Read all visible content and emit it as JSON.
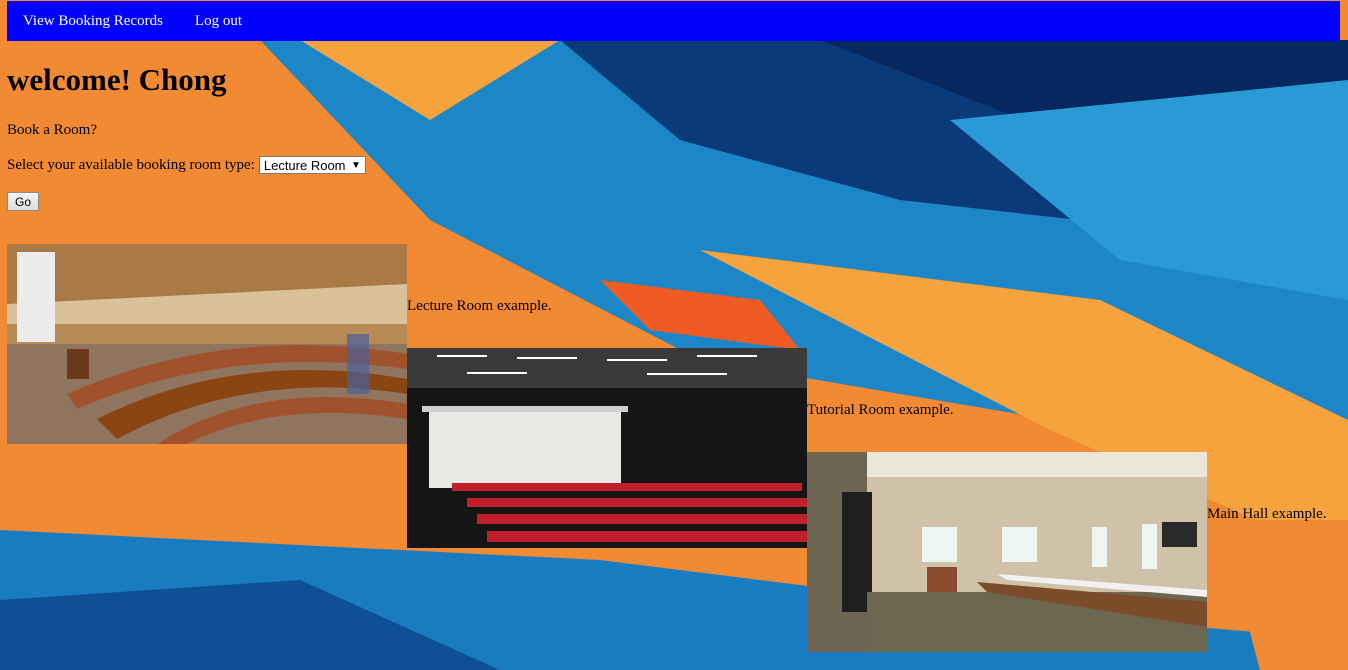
{
  "nav": {
    "links": [
      "View Booking Records",
      "Log out"
    ]
  },
  "welcome": "welcome! Chong",
  "book_prompt": "Book a Room?",
  "select_label": "Select your available booking room type:",
  "select_value": "Lecture Room",
  "go_label": "Go",
  "rooms": [
    {
      "caption": "Lecture Room example."
    },
    {
      "caption": "Tutorial Room example."
    },
    {
      "caption": "Main Hall example."
    }
  ],
  "colors": {
    "nav_bg": "#0000ff",
    "bg_orange": "#f28a34",
    "bg_blue": "#1f7fc0",
    "bg_darkblue": "#0b2f6b"
  }
}
